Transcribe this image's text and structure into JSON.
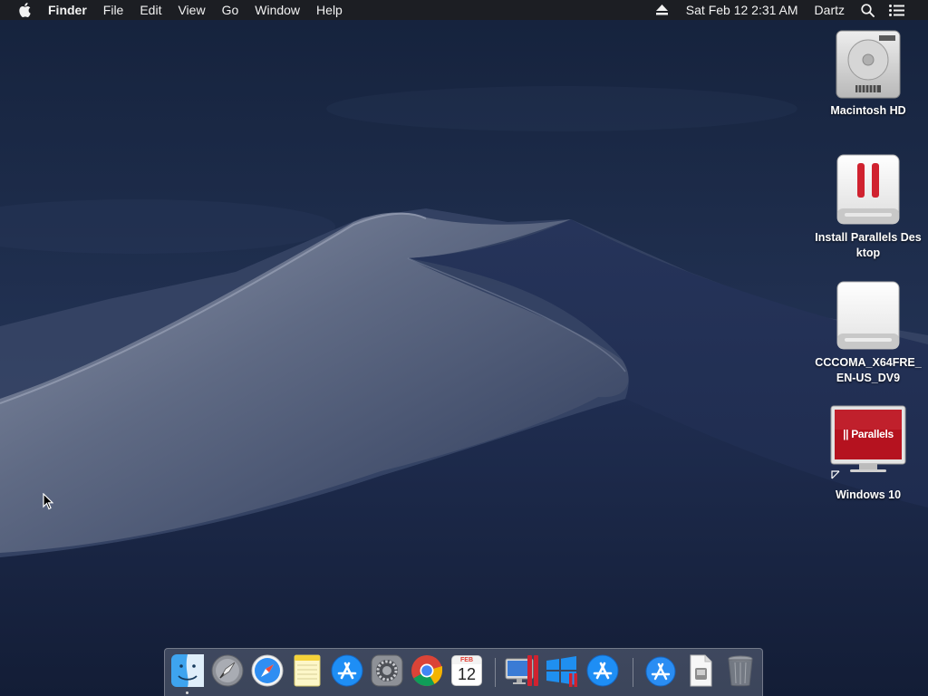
{
  "menubar": {
    "app_name": "Finder",
    "items": [
      "File",
      "Edit",
      "View",
      "Go",
      "Window",
      "Help"
    ],
    "clock": "Sat Feb 12  2:31 AM",
    "user": "Dartz"
  },
  "desktop_icons": [
    {
      "label": "Macintosh HD",
      "icon": "hard-drive-icon"
    },
    {
      "label": "Install Parallels Desktop",
      "icon": "parallels-installer-disk-icon"
    },
    {
      "label": "CCCOMA_X64FRE_EN-US_DV9",
      "icon": "external-drive-icon"
    },
    {
      "label": "Windows 10",
      "icon": "parallels-vm-icon",
      "badge_text": "|| Parallels"
    }
  ],
  "dock": {
    "calendar_month": "FEB",
    "calendar_day": "12",
    "apps": [
      "finder-icon",
      "launchpad-icon",
      "safari-icon",
      "notes-icon",
      "app-store-icon",
      "system-preferences-icon",
      "chrome-icon",
      "calendar-icon",
      "parallels-control-center-icon",
      "windows-parallels-icon",
      "app-store-icon",
      "downloads-folder-icon",
      "document-icon",
      "trash-icon"
    ]
  },
  "colors": {
    "menubar_bg": "#1e1e20",
    "parallels_red": "#d0222f"
  }
}
